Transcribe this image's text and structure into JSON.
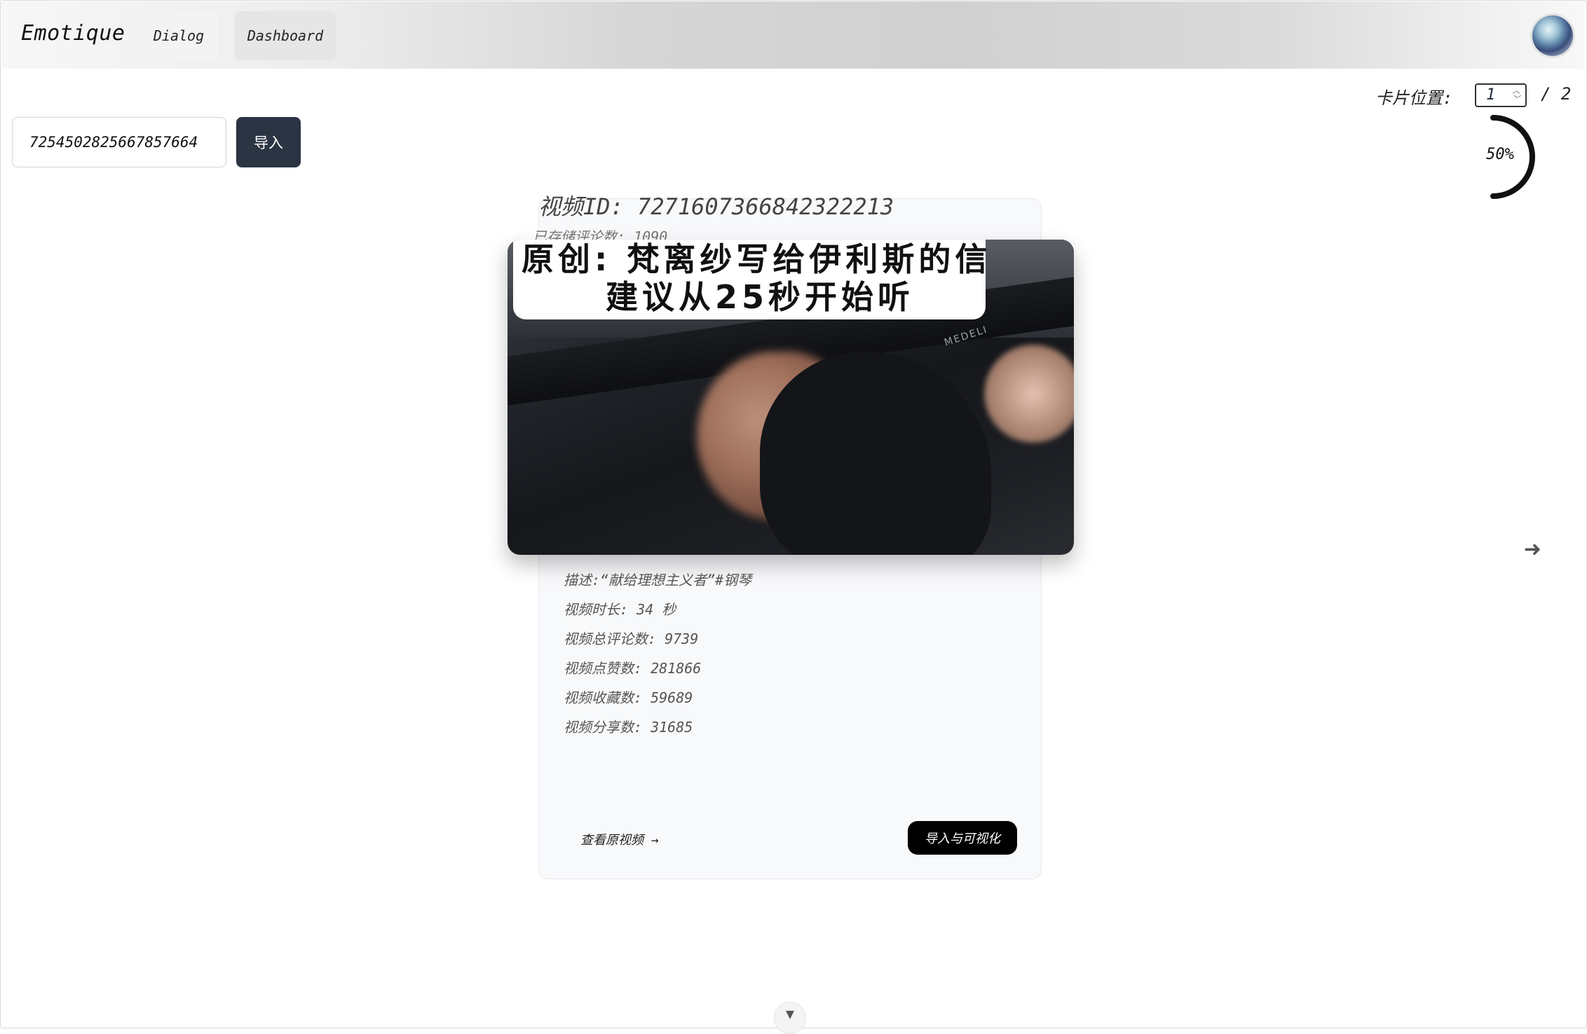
{
  "header": {
    "brand": "Emotique",
    "nav": [
      {
        "label": "Dialog"
      },
      {
        "label": "Dashboard"
      }
    ],
    "avatar_icon": "user-avatar-icon"
  },
  "import": {
    "video_id_value": "7254502825667857664",
    "button_label": "导入"
  },
  "card_position": {
    "label": "卡片位置:",
    "current": "1",
    "total": "/ 2"
  },
  "progress": {
    "value_percent": 50,
    "text": "50%"
  },
  "card": {
    "video_id_line": "视频ID: 7271607366842322213",
    "stored_comments": "已存储评论数: 1090",
    "cover_title_line1": "原创: 梵离纱写给伊利斯的信",
    "cover_title_line2": "建议从25秒开始听",
    "cover_brand": "MEDELI",
    "details": [
      "描述:“献给理想主义者”#钢琴",
      "视频时长: 34 秒",
      "视频总评论数: 9739",
      "视频点赞数: 281866",
      "视频收藏数: 59689",
      "视频分享数: 31685"
    ],
    "view_link": "查看原视频 →",
    "visualize_button": "导入与可视化"
  },
  "icons": {
    "next": "arrow-right-icon",
    "scroll_down": "chevron-down-icon"
  }
}
